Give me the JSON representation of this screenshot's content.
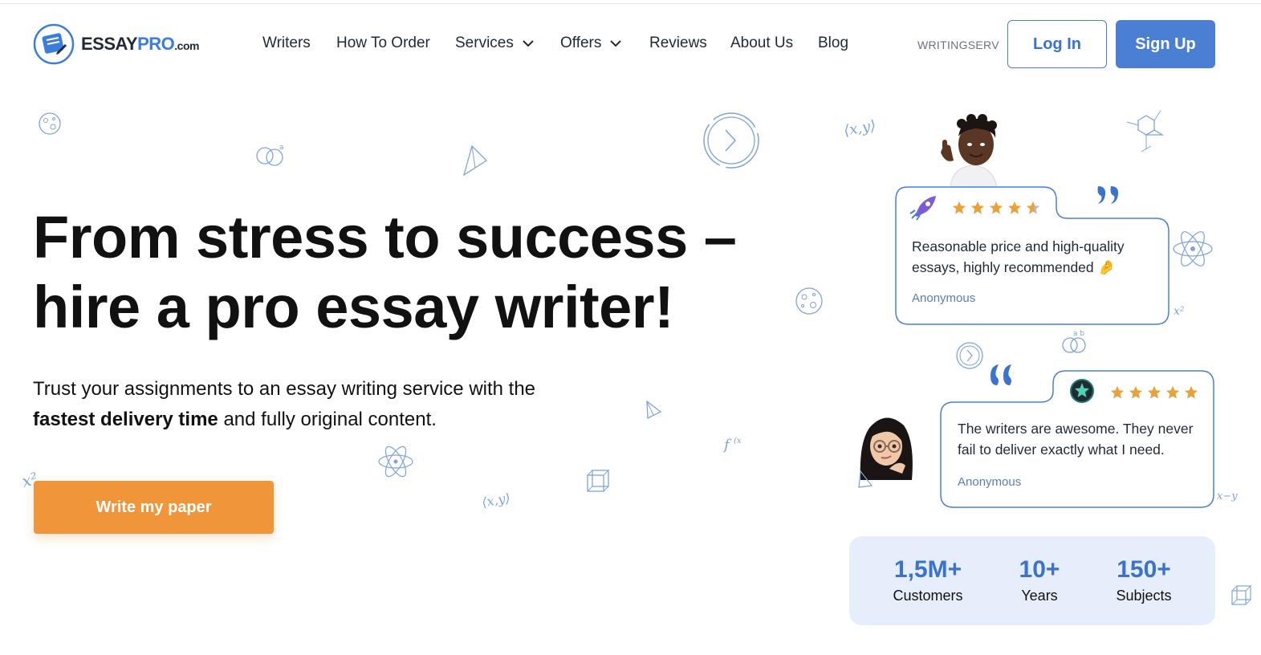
{
  "header": {
    "logo": {
      "name": "ESSAY",
      "name_accent": "PRO",
      "suffix": ".com"
    },
    "nav": [
      {
        "label": "Writers"
      },
      {
        "label": "How To Order"
      },
      {
        "label": "Services",
        "dropdown": true
      },
      {
        "label": "Offers",
        "dropdown": true
      },
      {
        "label": "Reviews"
      },
      {
        "label": "About Us"
      },
      {
        "label": "Blog"
      }
    ],
    "partner_code": "WRITINGSERV",
    "login_label": "Log In",
    "signup_label": "Sign Up"
  },
  "hero": {
    "title_line1": "From stress to success –",
    "title_line2": "hire a pro essay writer!",
    "subtitle_pre": "Trust your assignments to an essay writing service with the",
    "subtitle_bold": "fastest delivery time",
    "subtitle_post": "and fully original content.",
    "cta_label": "Write my paper"
  },
  "reviews": [
    {
      "text": "Reasonable price and high-quality essays, highly recommended 🤌",
      "author": "Anonymous",
      "rating": 4.5,
      "badge_icon": "rocket-icon"
    },
    {
      "text": "The writers are awesome. They never fail to deliver exactly what I need.",
      "author": "Anonymous",
      "rating": 5,
      "badge_icon": "star-badge-icon"
    }
  ],
  "stats": [
    {
      "value": "1,5M+",
      "label": "Customers"
    },
    {
      "value": "10+",
      "label": "Years"
    },
    {
      "value": "150+",
      "label": "Subjects"
    }
  ],
  "colors": {
    "accent": "#4a7fd4",
    "cta": "#f0953a",
    "star": "#e9a23b",
    "stats_bg": "#e6eefb",
    "doodle": "#7ea3de"
  }
}
